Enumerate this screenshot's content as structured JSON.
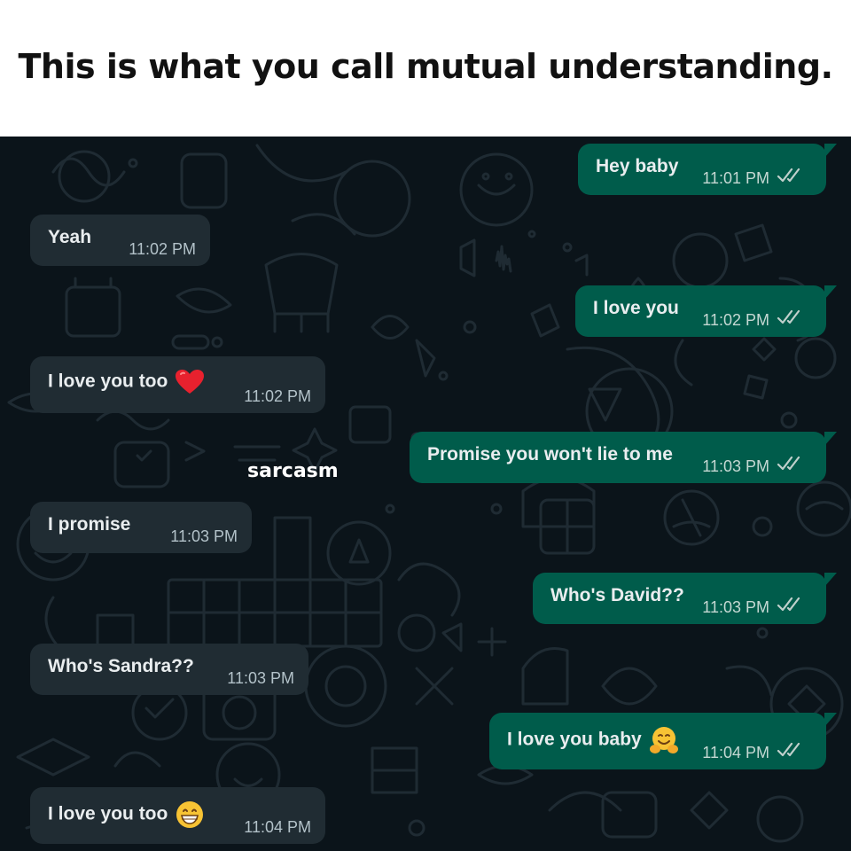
{
  "caption": "This is what you call mutual understanding.",
  "side_note": "sarcasm",
  "colors": {
    "chat_background": "#0b141a",
    "incoming_bubble": "#202c33",
    "outgoing_bubble": "#005c4b",
    "message_text": "#e9edef",
    "timestamp_text": "#b3c2c9"
  },
  "messages": [
    {
      "direction": "outgoing",
      "text": "Hey baby",
      "time": "11:01 PM",
      "status_icon": "double-check-icon"
    },
    {
      "direction": "incoming",
      "text": "Yeah",
      "time": "11:02 PM"
    },
    {
      "direction": "outgoing",
      "text": "I love you",
      "time": "11:02 PM",
      "status_icon": "double-check-icon"
    },
    {
      "direction": "incoming",
      "text": "I love you too",
      "time": "11:02 PM",
      "emoji": "red-heart-emoji"
    },
    {
      "direction": "outgoing",
      "text": "Promise you won't lie to me",
      "time": "11:03 PM",
      "status_icon": "double-check-icon"
    },
    {
      "direction": "incoming",
      "text": "I promise",
      "time": "11:03 PM"
    },
    {
      "direction": "outgoing",
      "text": "Who's David??",
      "time": "11:03 PM",
      "status_icon": "double-check-icon"
    },
    {
      "direction": "incoming",
      "text": "Who's Sandra??",
      "time": "11:03 PM"
    },
    {
      "direction": "outgoing",
      "text": "I love you baby",
      "time": "11:04 PM",
      "status_icon": "double-check-icon",
      "emoji": "hugging-face-emoji"
    },
    {
      "direction": "incoming",
      "text": "I love you too",
      "time": "11:04 PM",
      "emoji": "grinning-face-emoji"
    }
  ]
}
